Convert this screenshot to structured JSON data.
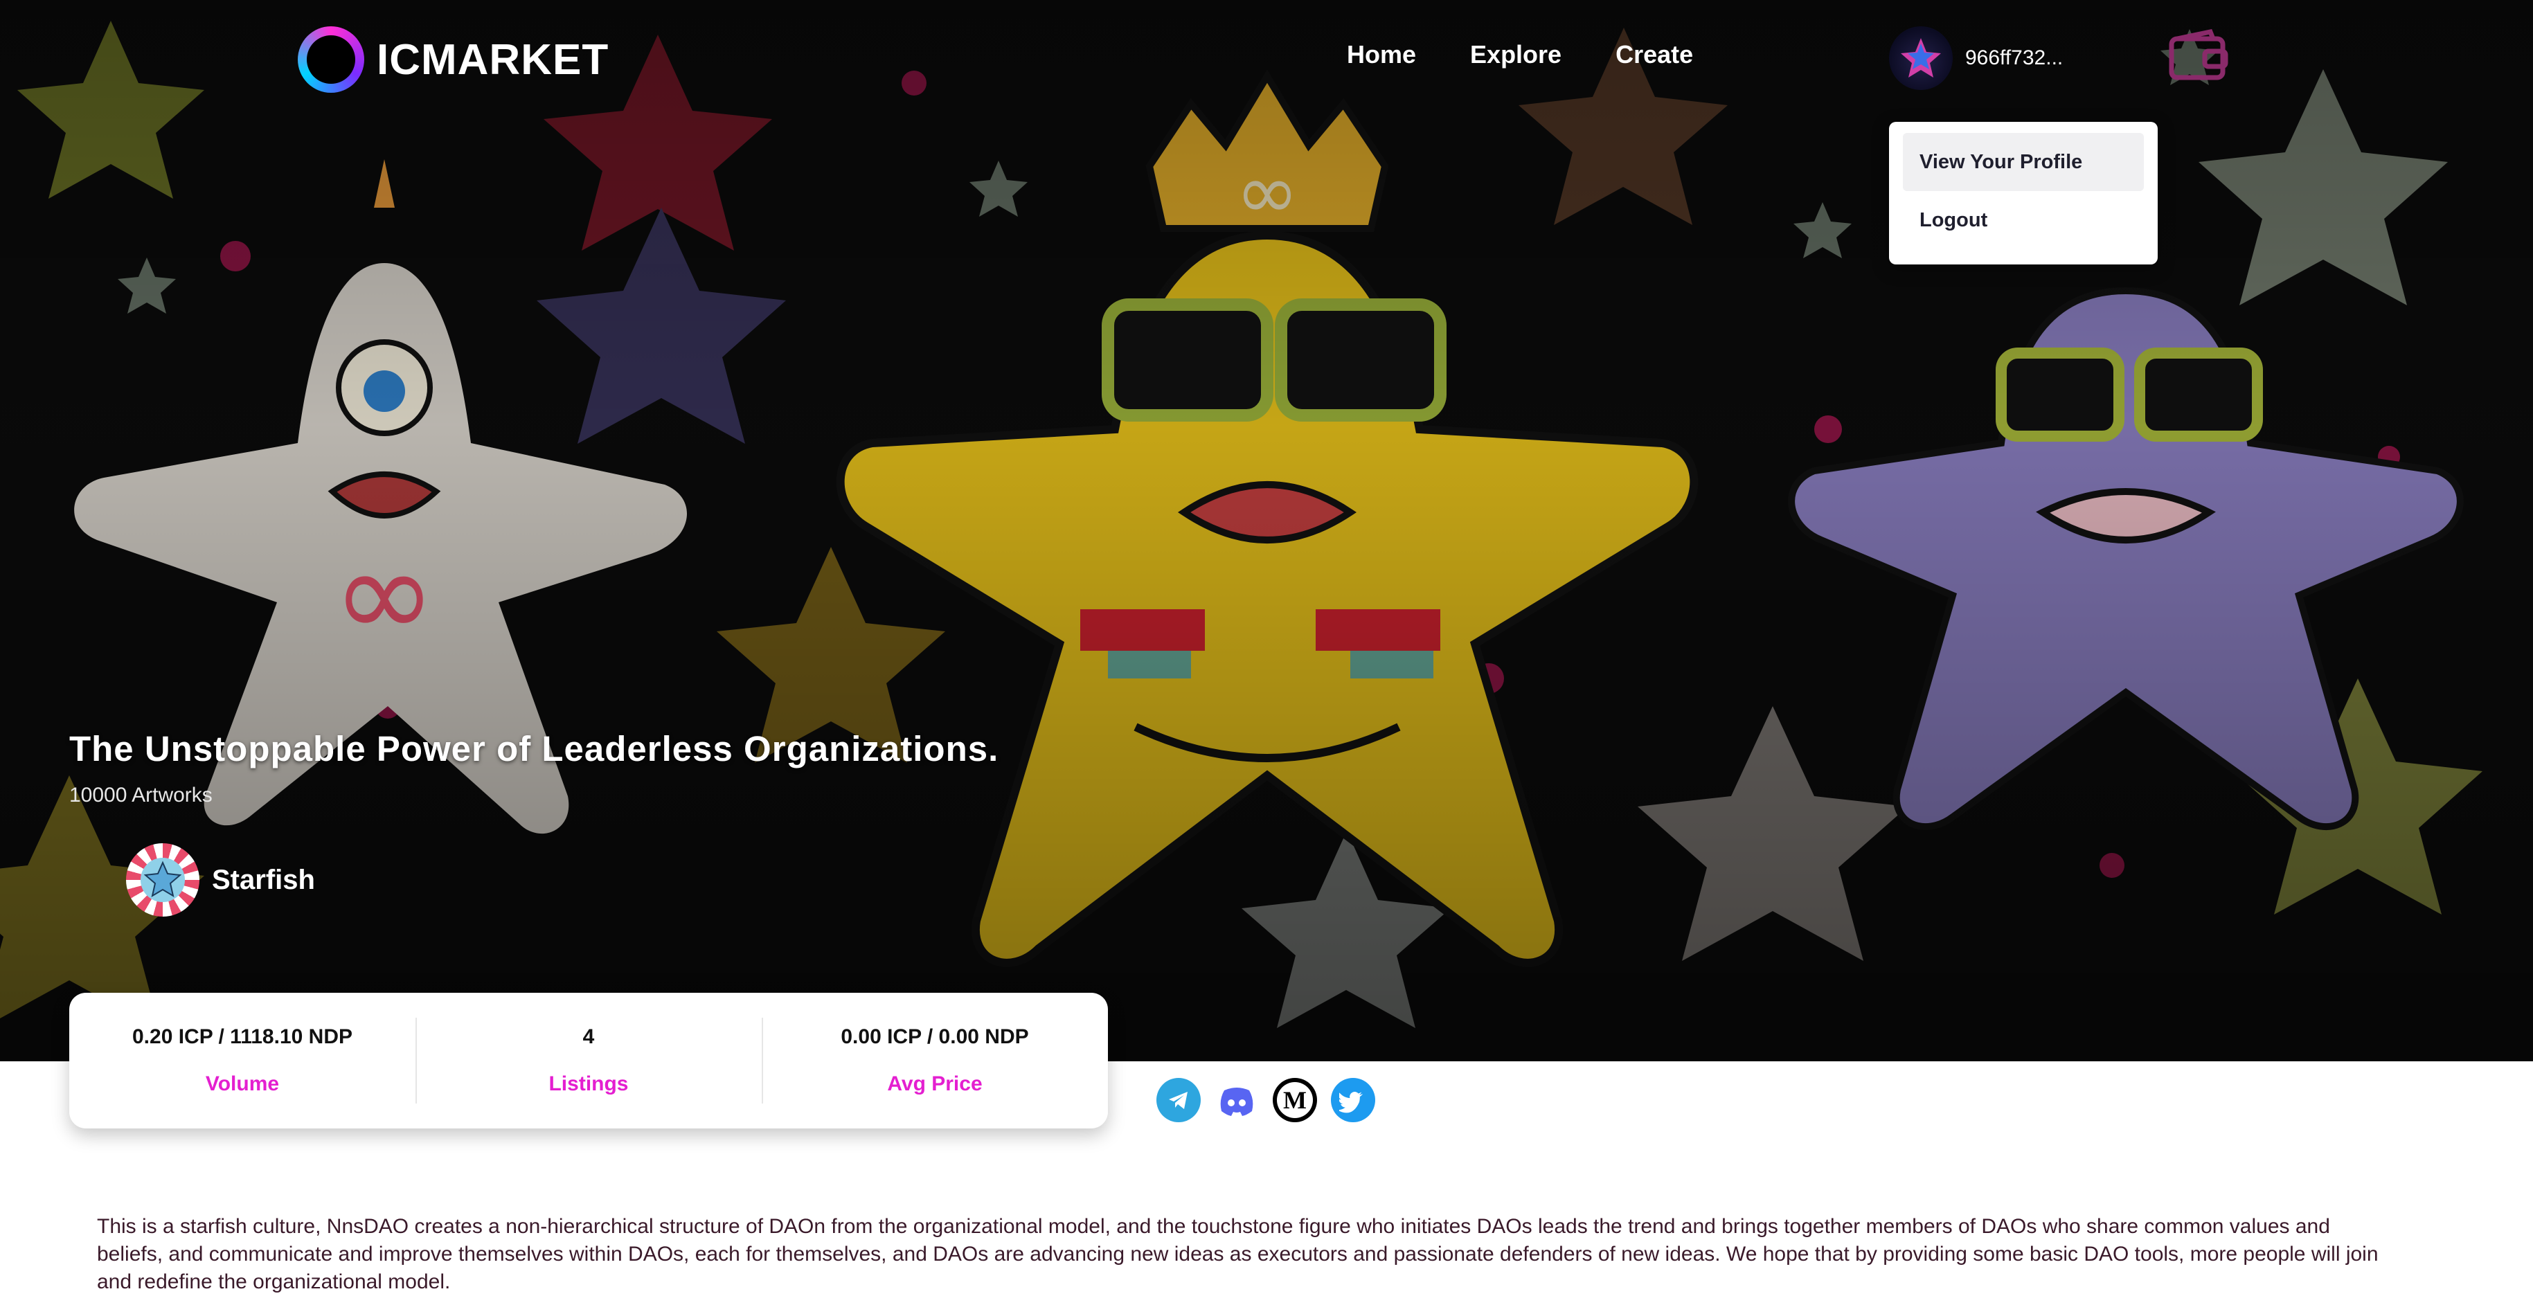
{
  "header": {
    "logo_text": "ICMARKET",
    "nav": [
      {
        "label": "Home"
      },
      {
        "label": "Explore"
      },
      {
        "label": "Create"
      }
    ],
    "account_id": "966ff732...",
    "dropdown": {
      "items": [
        {
          "label": "View Your Profile"
        },
        {
          "label": "Logout"
        }
      ]
    }
  },
  "collection": {
    "title": "The Unstoppable Power of Leaderless Organizations.",
    "artworks": "10000 Artworks",
    "creator": "Starfish"
  },
  "stats": [
    {
      "value": "0.20 ICP / 1118.10 NDP",
      "label": "Volume"
    },
    {
      "value": "4",
      "label": "Listings"
    },
    {
      "value": "0.00 ICP / 0.00 NDP",
      "label": "Avg Price"
    }
  ],
  "socials": [
    {
      "icon": "telegram-icon",
      "color": "#2ea6df"
    },
    {
      "icon": "discord-icon",
      "color": "#5865f2"
    },
    {
      "icon": "medium-icon",
      "color": "#000000"
    },
    {
      "icon": "twitter-icon",
      "color": "#1d9bf0"
    }
  ],
  "description": "This is a starfish culture, NnsDAO creates a non-hierarchical structure of DAOn from the organizational model, and the touchstone figure who initiates DAOs leads the trend and brings together members of DAOs who share common values and beliefs, and communicate and improve themselves within DAOs, each for themselves, and DAOs are advancing new ideas as executors and passionate defenders of new ideas. We hope that by providing some basic DAO tools, more people will join and redefine the organizational model.",
  "colors": {
    "accent": "#e41fd0",
    "hero_bg": "#0b0b0b"
  }
}
